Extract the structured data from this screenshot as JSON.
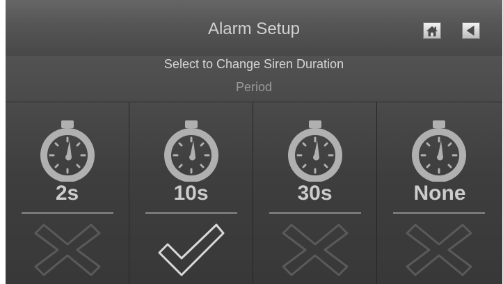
{
  "header": {
    "title": "Alarm Setup",
    "home_icon": "home-icon",
    "back_icon": "back-arrow-icon"
  },
  "instructions": {
    "line1": "Select to Change Siren Duration",
    "line2": "Period"
  },
  "options": [
    {
      "label": "2s",
      "selected": false,
      "icon": "stopwatch-icon",
      "state_icon": "x-icon"
    },
    {
      "label": "10s",
      "selected": true,
      "icon": "stopwatch-icon",
      "state_icon": "checkmark-icon"
    },
    {
      "label": "30s",
      "selected": false,
      "icon": "stopwatch-icon",
      "state_icon": "x-icon"
    },
    {
      "label": "None",
      "selected": false,
      "icon": "stopwatch-icon",
      "state_icon": "x-icon"
    }
  ],
  "colors": {
    "background": "#3d3d3d",
    "text": "#cccccc",
    "icon": "#b0b0b0",
    "unselected_mark": "#5a5a5a",
    "selected_mark": "#d9d9d9"
  }
}
